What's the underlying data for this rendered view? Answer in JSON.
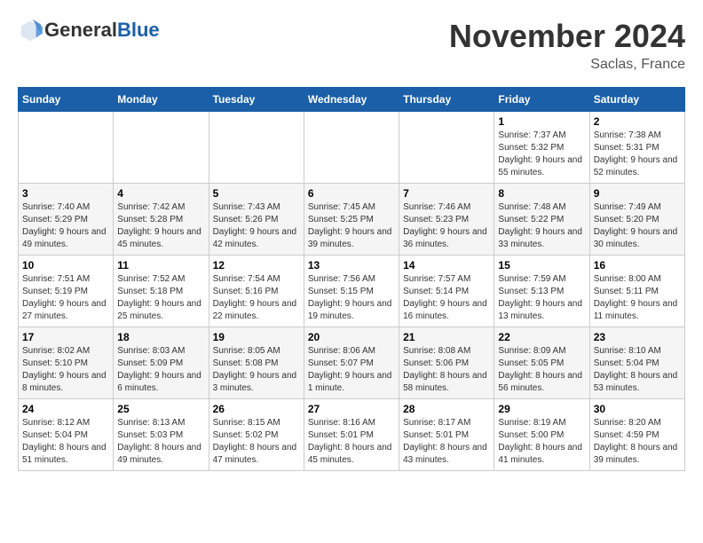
{
  "header": {
    "logo_general": "General",
    "logo_blue": "Blue",
    "month_title": "November 2024",
    "location": "Saclas, France"
  },
  "weekdays": [
    "Sunday",
    "Monday",
    "Tuesday",
    "Wednesday",
    "Thursday",
    "Friday",
    "Saturday"
  ],
  "weeks": [
    [
      {
        "day": "",
        "info": ""
      },
      {
        "day": "",
        "info": ""
      },
      {
        "day": "",
        "info": ""
      },
      {
        "day": "",
        "info": ""
      },
      {
        "day": "",
        "info": ""
      },
      {
        "day": "1",
        "info": "Sunrise: 7:37 AM\nSunset: 5:32 PM\nDaylight: 9 hours and 55 minutes."
      },
      {
        "day": "2",
        "info": "Sunrise: 7:38 AM\nSunset: 5:31 PM\nDaylight: 9 hours and 52 minutes."
      }
    ],
    [
      {
        "day": "3",
        "info": "Sunrise: 7:40 AM\nSunset: 5:29 PM\nDaylight: 9 hours and 49 minutes."
      },
      {
        "day": "4",
        "info": "Sunrise: 7:42 AM\nSunset: 5:28 PM\nDaylight: 9 hours and 45 minutes."
      },
      {
        "day": "5",
        "info": "Sunrise: 7:43 AM\nSunset: 5:26 PM\nDaylight: 9 hours and 42 minutes."
      },
      {
        "day": "6",
        "info": "Sunrise: 7:45 AM\nSunset: 5:25 PM\nDaylight: 9 hours and 39 minutes."
      },
      {
        "day": "7",
        "info": "Sunrise: 7:46 AM\nSunset: 5:23 PM\nDaylight: 9 hours and 36 minutes."
      },
      {
        "day": "8",
        "info": "Sunrise: 7:48 AM\nSunset: 5:22 PM\nDaylight: 9 hours and 33 minutes."
      },
      {
        "day": "9",
        "info": "Sunrise: 7:49 AM\nSunset: 5:20 PM\nDaylight: 9 hours and 30 minutes."
      }
    ],
    [
      {
        "day": "10",
        "info": "Sunrise: 7:51 AM\nSunset: 5:19 PM\nDaylight: 9 hours and 27 minutes."
      },
      {
        "day": "11",
        "info": "Sunrise: 7:52 AM\nSunset: 5:18 PM\nDaylight: 9 hours and 25 minutes."
      },
      {
        "day": "12",
        "info": "Sunrise: 7:54 AM\nSunset: 5:16 PM\nDaylight: 9 hours and 22 minutes."
      },
      {
        "day": "13",
        "info": "Sunrise: 7:56 AM\nSunset: 5:15 PM\nDaylight: 9 hours and 19 minutes."
      },
      {
        "day": "14",
        "info": "Sunrise: 7:57 AM\nSunset: 5:14 PM\nDaylight: 9 hours and 16 minutes."
      },
      {
        "day": "15",
        "info": "Sunrise: 7:59 AM\nSunset: 5:13 PM\nDaylight: 9 hours and 13 minutes."
      },
      {
        "day": "16",
        "info": "Sunrise: 8:00 AM\nSunset: 5:11 PM\nDaylight: 9 hours and 11 minutes."
      }
    ],
    [
      {
        "day": "17",
        "info": "Sunrise: 8:02 AM\nSunset: 5:10 PM\nDaylight: 9 hours and 8 minutes."
      },
      {
        "day": "18",
        "info": "Sunrise: 8:03 AM\nSunset: 5:09 PM\nDaylight: 9 hours and 6 minutes."
      },
      {
        "day": "19",
        "info": "Sunrise: 8:05 AM\nSunset: 5:08 PM\nDaylight: 9 hours and 3 minutes."
      },
      {
        "day": "20",
        "info": "Sunrise: 8:06 AM\nSunset: 5:07 PM\nDaylight: 9 hours and 1 minute."
      },
      {
        "day": "21",
        "info": "Sunrise: 8:08 AM\nSunset: 5:06 PM\nDaylight: 8 hours and 58 minutes."
      },
      {
        "day": "22",
        "info": "Sunrise: 8:09 AM\nSunset: 5:05 PM\nDaylight: 8 hours and 56 minutes."
      },
      {
        "day": "23",
        "info": "Sunrise: 8:10 AM\nSunset: 5:04 PM\nDaylight: 8 hours and 53 minutes."
      }
    ],
    [
      {
        "day": "24",
        "info": "Sunrise: 8:12 AM\nSunset: 5:04 PM\nDaylight: 8 hours and 51 minutes."
      },
      {
        "day": "25",
        "info": "Sunrise: 8:13 AM\nSunset: 5:03 PM\nDaylight: 8 hours and 49 minutes."
      },
      {
        "day": "26",
        "info": "Sunrise: 8:15 AM\nSunset: 5:02 PM\nDaylight: 8 hours and 47 minutes."
      },
      {
        "day": "27",
        "info": "Sunrise: 8:16 AM\nSunset: 5:01 PM\nDaylight: 8 hours and 45 minutes."
      },
      {
        "day": "28",
        "info": "Sunrise: 8:17 AM\nSunset: 5:01 PM\nDaylight: 8 hours and 43 minutes."
      },
      {
        "day": "29",
        "info": "Sunrise: 8:19 AM\nSunset: 5:00 PM\nDaylight: 8 hours and 41 minutes."
      },
      {
        "day": "30",
        "info": "Sunrise: 8:20 AM\nSunset: 4:59 PM\nDaylight: 8 hours and 39 minutes."
      }
    ]
  ]
}
